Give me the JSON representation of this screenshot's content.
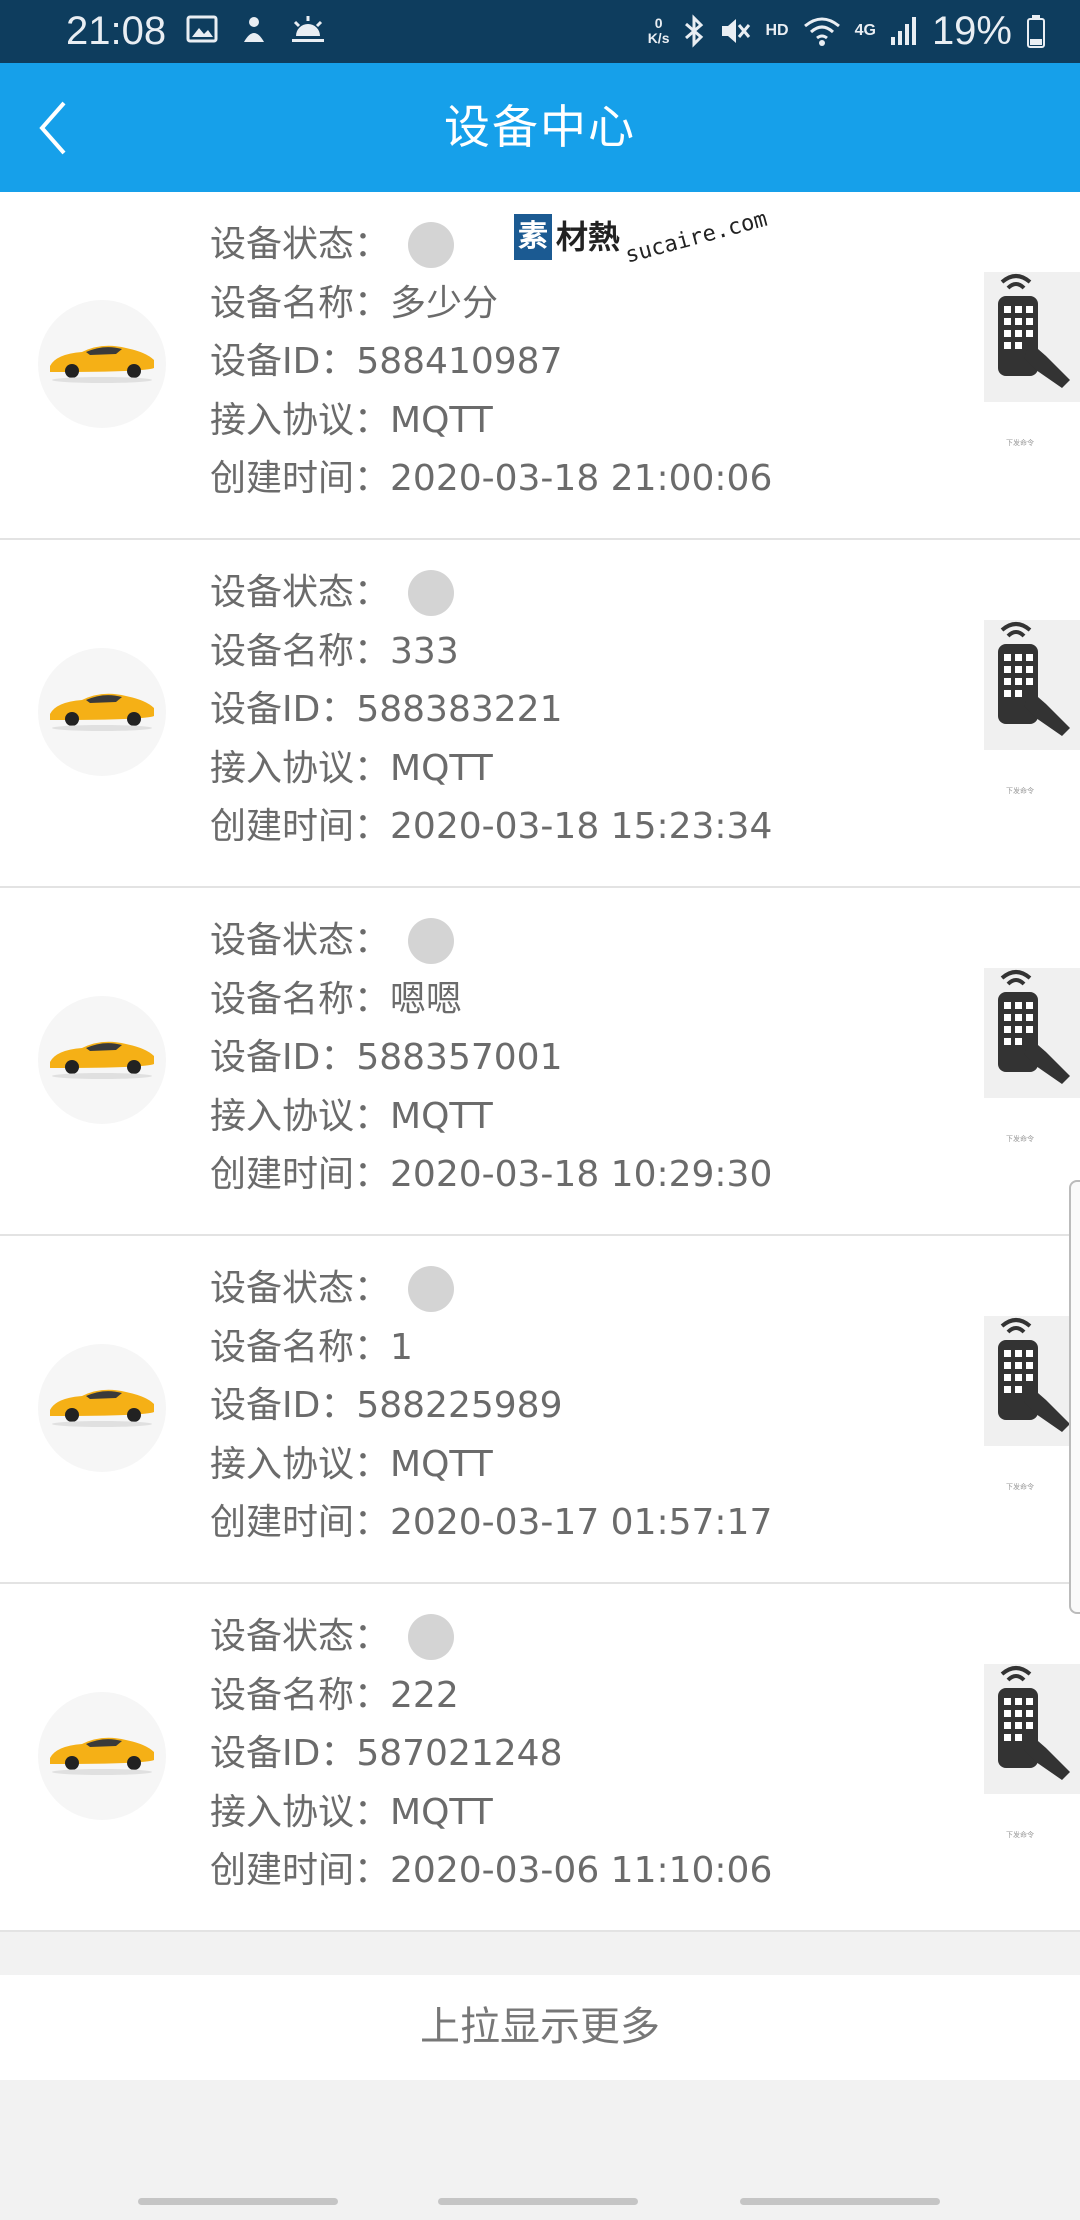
{
  "status_bar": {
    "time": "21:08",
    "net_speed_top": "0",
    "net_speed_bottom": "K/s",
    "hd": "HD",
    "network": "4G",
    "battery": "19%",
    "icons": [
      "image-icon",
      "notification-icon",
      "weather-icon",
      "bluetooth-icon",
      "mute-icon",
      "wifi-icon",
      "signal-icon",
      "battery-icon"
    ]
  },
  "header": {
    "title": "设备中心",
    "back_icon": "chevron-left-icon"
  },
  "labels": {
    "status": "设备状态：",
    "name": "设备名称：",
    "id": "设备ID：",
    "protocol": "接入协议：",
    "created": "创建时间："
  },
  "devices": [
    {
      "name": "多少分",
      "id": "588410987",
      "protocol": "MQTT",
      "created": "2020-03-18 21:00:06"
    },
    {
      "name": "333",
      "id": "588383221",
      "protocol": "MQTT",
      "created": "2020-03-18 15:23:34"
    },
    {
      "name": "嗯嗯",
      "id": "588357001",
      "protocol": "MQTT",
      "created": "2020-03-18 10:29:30"
    },
    {
      "name": "1",
      "id": "588225989",
      "protocol": "MQTT",
      "created": "2020-03-17 01:57:17"
    },
    {
      "name": "222",
      "id": "587021248",
      "protocol": "MQTT",
      "created": "2020-03-06 11:10:06"
    }
  ],
  "remote_caption": "下发命令",
  "load_more": "上拉显示更多",
  "watermark": {
    "badge": "素",
    "text": "材熱",
    "domain": "sucaire.com"
  },
  "colors": {
    "header": "#16a0ea",
    "status_bar": "#0e3d5e",
    "status_dot": "#d4d4d4",
    "car": "#f5b016"
  }
}
